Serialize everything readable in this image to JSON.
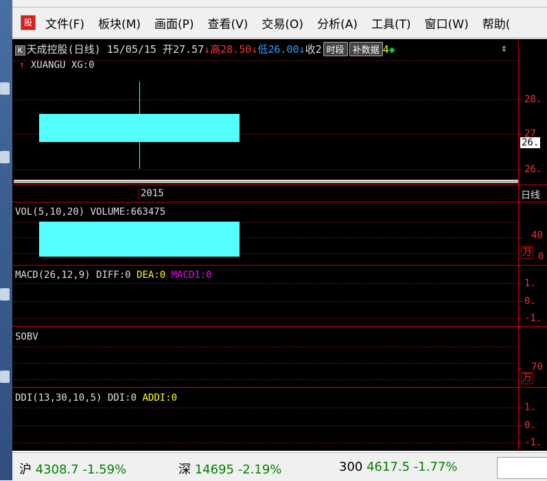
{
  "menu": {
    "logo_icon": "app-logo-icon",
    "items": [
      "文件(F)",
      "板块(M)",
      "画面(P)",
      "查看(V)",
      "交易(O)",
      "分析(A)",
      "工具(T)",
      "窗口(W)",
      "帮助("
    ]
  },
  "chart": {
    "title": {
      "k_label": "K",
      "stock": "天成控股(日线)",
      "date": "15/05/15",
      "open": "开27.57",
      "high": "高28.50",
      "low": "低26.00",
      "close": "收2",
      "btn_period": "时段",
      "btn_supplement": "补数据",
      "tail": "4"
    },
    "indicator_line": "XUANGU XG:0",
    "price_ticks": [
      "28.",
      "27",
      "26.",
      "26."
    ],
    "date_label": "2015",
    "right_date_label": "日线",
    "vol": {
      "label": "VOL(5,10,20) VOLUME:663475",
      "tick": "40",
      "unit": "万",
      "unit_tail": "0"
    },
    "macd": {
      "label": "MACD(26,12,9)",
      "diff": "DIFF:0",
      "dea": "DEA:0",
      "macd1": "MACD1:0",
      "ticks": [
        "1.",
        "0.",
        "-1."
      ]
    },
    "sobv": {
      "label": "SOBV",
      "tick": "70",
      "unit": "万"
    },
    "ddi": {
      "label": "DDI(13,30,10,5)",
      "ddi": "DDI:0",
      "addi": "ADDI:0",
      "ticks": [
        "1.",
        "0.",
        "-1."
      ]
    }
  },
  "status": {
    "sh": {
      "name": "沪",
      "value": "4308.7",
      "change": "-1.59%"
    },
    "sz": {
      "name": "深",
      "value": "14695",
      "change": "-2.19%"
    },
    "hs300": {
      "name": "300",
      "value": "4617.5",
      "change": "-1.77%"
    }
  },
  "colors": {
    "candle": "#54ffff",
    "grid": "#cc0000",
    "background": "#000000"
  }
}
